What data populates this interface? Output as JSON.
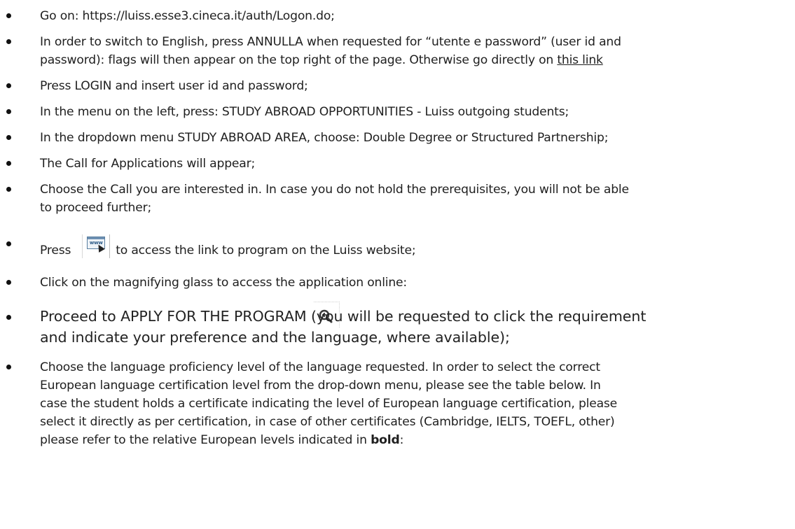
{
  "items": [
    {
      "text": "Go on: https://luiss.esse3.cineca.it/auth/Logon.do;"
    },
    {
      "line1": "In order to switch to English, press ANNULLA when requested for “utente e password” (user id and",
      "line2_prefix": "password): flags will then appear on the top right of the page. Otherwise go directly on ",
      "link": "this link"
    },
    {
      "text": "Press LOGIN and insert user id and password;"
    },
    {
      "text": "In the menu on the left, press: STUDY ABROAD OPPORTUNITIES - Luiss outgoing students;"
    },
    {
      "text": "In the dropdown menu STUDY ABROAD AREA, choose: Double Degree or Structured Partnership;"
    },
    {
      "text": "The Call for Applications will appear;"
    },
    {
      "line1": "Choose the Call you are interested in. In case you do not hold the prerequisites, you will not be able",
      "line2": "to proceed further;"
    },
    {
      "prefix": "Press",
      "icon_text": "www",
      "suffix": "to access the link to program on the Luiss website;"
    },
    {
      "text": "Click on the magnifying glass to access the application online:"
    },
    {
      "line1": "Proceed to APPLY FOR THE PROGRAM (you will be requested to click the requirement",
      "line2": "and indicate your preference and the language, where available);"
    },
    {
      "line1": "Choose the language proficiency level of the language requested. In order to select the correct",
      "line2": "European language certification level from the drop-down menu, please see the table below. In",
      "line3": "case the student holds a certificate indicating the level of European language certification, please",
      "line4": "select it directly as per certification, in case of other certificates (Cambridge, IELTS, TOEFL, other)",
      "line5_prefix": "please refer to the relative European levels indicated in ",
      "line5_bold": "bold",
      "line5_suffix": ":"
    }
  ],
  "icons": {
    "www_button": "www-link-icon",
    "magnifier": "magnifying-glass-plus-icon"
  }
}
